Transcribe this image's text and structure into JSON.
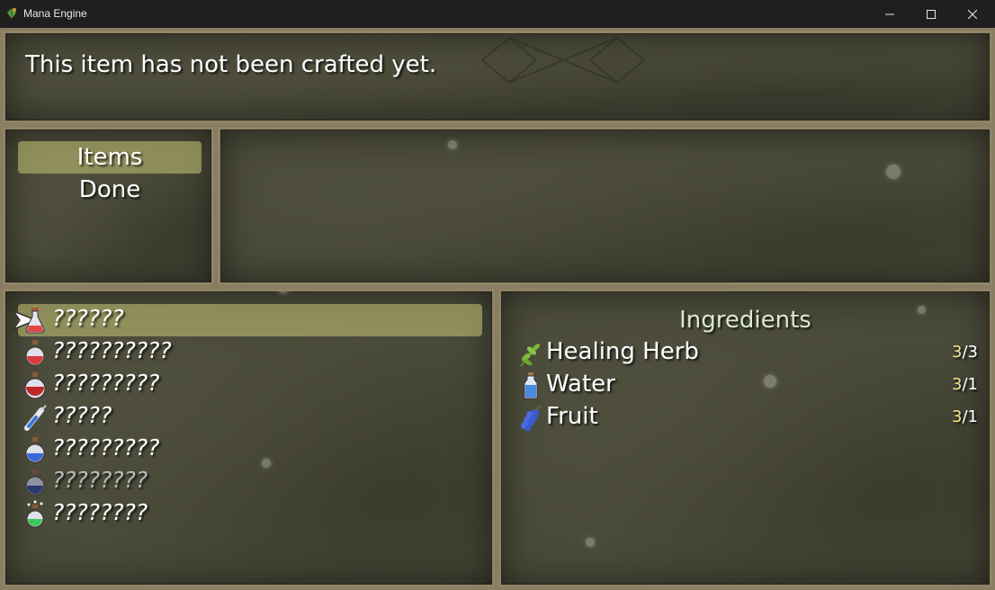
{
  "window": {
    "title": "Mana Engine"
  },
  "help": {
    "text": "This item has not been crafted yet."
  },
  "categories": [
    {
      "label": "Items",
      "selected": true
    },
    {
      "label": "Done",
      "selected": false
    }
  ],
  "items": [
    {
      "name": "??????",
      "icon": "potion-flask-icon",
      "selected": true,
      "enabled": true
    },
    {
      "name": "??????????",
      "icon": "red-potion-icon",
      "selected": false,
      "enabled": true
    },
    {
      "name": "?????????",
      "icon": "red-potion-icon",
      "selected": false,
      "enabled": true
    },
    {
      "name": "?????",
      "icon": "syringe-icon",
      "selected": false,
      "enabled": true
    },
    {
      "name": "?????????",
      "icon": "blue-potion-icon",
      "selected": false,
      "enabled": true
    },
    {
      "name": "????????",
      "icon": "dark-blue-potion-icon",
      "selected": false,
      "enabled": false
    },
    {
      "name": "????????",
      "icon": "green-potion-icon",
      "selected": false,
      "enabled": true
    }
  ],
  "ingredients": {
    "title": "Ingredients",
    "list": [
      {
        "name": "Healing Herb",
        "icon": "herb-icon",
        "have": "3",
        "need": "3"
      },
      {
        "name": "Water",
        "icon": "water-bottle-icon",
        "have": "3",
        "need": "1"
      },
      {
        "name": "Fruit",
        "icon": "grape-fruit-icon",
        "have": "3",
        "need": "1"
      }
    ]
  },
  "colors": {
    "highlight": "#c8c878",
    "window_border": "#8f8468",
    "window_bg": "#4a4a3a",
    "quantity_have": "#f0e68c"
  }
}
